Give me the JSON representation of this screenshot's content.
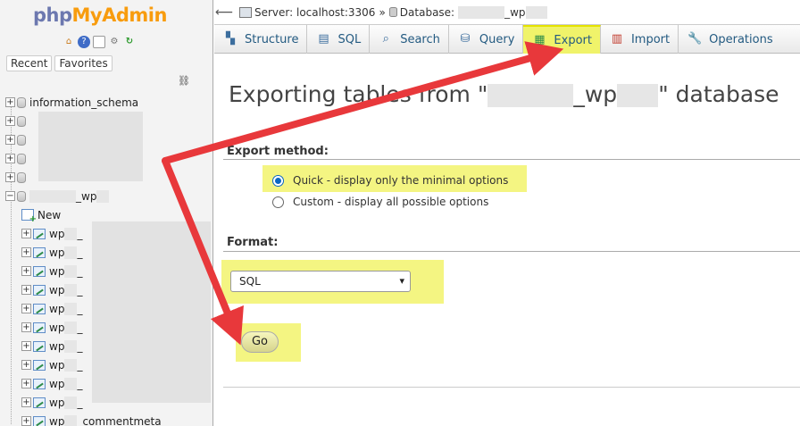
{
  "app": {
    "logo_php": "php",
    "logo_pma": "MyAdmin"
  },
  "nav": {
    "tabs": [
      "Recent",
      "Favorites"
    ],
    "icons": [
      "home-icon",
      "help-icon",
      "docs-icon",
      "settings-icon",
      "reload-icon"
    ],
    "databases": [
      {
        "name": "information_schema"
      },
      {
        "name": "_wp",
        "expanded": true
      }
    ],
    "new_label": "New",
    "tables": [
      {
        "prefix": "wp",
        "suffix": "_"
      },
      {
        "prefix": "wp",
        "suffix": "_"
      },
      {
        "prefix": "wp",
        "suffix": "_"
      },
      {
        "prefix": "wp",
        "suffix": "_"
      },
      {
        "prefix": "wp",
        "suffix": "_"
      },
      {
        "prefix": "wp",
        "suffix": "_"
      },
      {
        "prefix": "wp",
        "suffix": "_"
      },
      {
        "prefix": "wp",
        "suffix": "_"
      },
      {
        "prefix": "wp",
        "suffix": "_"
      },
      {
        "prefix": "wp",
        "suffix": "_"
      },
      {
        "prefix": "wp",
        "suffix": "_commentmeta"
      }
    ]
  },
  "breadcrumb": {
    "server": "Server: localhost:3306",
    "separator": "»",
    "database_label": "Database:",
    "database_suffix": "_wp"
  },
  "tabs": [
    {
      "label": "Structure",
      "icon": "structure-icon"
    },
    {
      "label": "SQL",
      "icon": "sql-icon"
    },
    {
      "label": "Search",
      "icon": "search-icon"
    },
    {
      "label": "Query",
      "icon": "query-icon"
    },
    {
      "label": "Export",
      "icon": "export-icon",
      "active": true
    },
    {
      "label": "Import",
      "icon": "import-icon"
    },
    {
      "label": "Operations",
      "icon": "operations-icon"
    }
  ],
  "main": {
    "title_prefix": "Exporting tables from \"",
    "title_mid": "_wp",
    "title_suffix": "\" database",
    "export_method_label": "Export method:",
    "method_options": [
      {
        "label": "Quick - display only the minimal options",
        "checked": true
      },
      {
        "label": "Custom - display all possible options",
        "checked": false
      }
    ],
    "format_label": "Format:",
    "format_value": "SQL",
    "go_label": "Go"
  },
  "colors": {
    "highlight": "#f4f582",
    "arrow": "#e8383b",
    "active_tab": "#f0f36a",
    "link": "#235a81"
  }
}
